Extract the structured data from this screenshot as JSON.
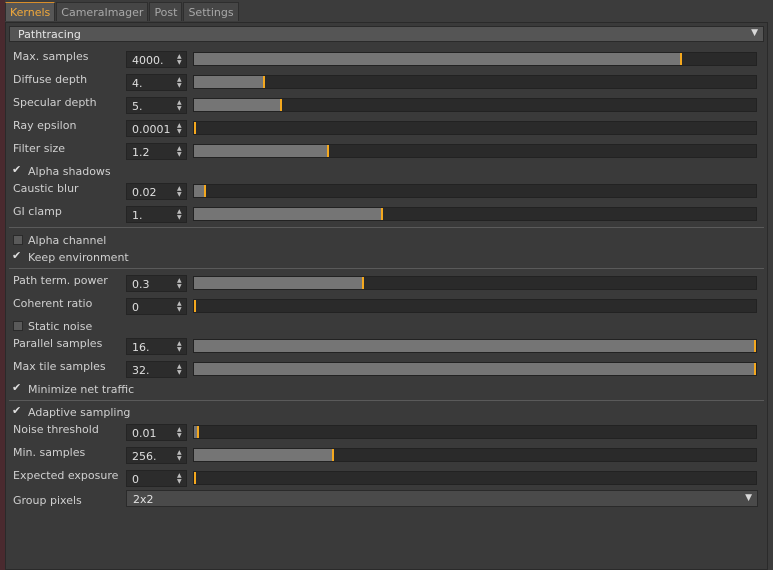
{
  "tabs": [
    "Kernels",
    "CameraImager",
    "Post",
    "Settings"
  ],
  "section": {
    "title": "Pathtracing"
  },
  "params": {
    "max_samples": {
      "label": "Max. samples",
      "value": "4000.",
      "level": 0.867
    },
    "diffuse_depth": {
      "label": "Diffuse depth",
      "value": "4.",
      "level": 0.125
    },
    "specular_depth": {
      "label": "Specular depth",
      "value": "5.",
      "level": 0.155
    },
    "ray_epsilon": {
      "label": "Ray epsilon",
      "value": "0.0001",
      "level": 0.0
    },
    "filter_size": {
      "label": "Filter size",
      "value": "1.2",
      "level": 0.238
    },
    "caustic_blur": {
      "label": "Caustic blur",
      "value": "0.02",
      "level": 0.02
    },
    "gi_clamp": {
      "label": "GI clamp",
      "value": "1.",
      "level": 0.335
    },
    "path_term_power": {
      "label": "Path term. power",
      "value": "0.3",
      "level": 0.3
    },
    "coherent_ratio": {
      "label": "Coherent ratio",
      "value": "0",
      "level": 0.0
    },
    "parallel_samples": {
      "label": "Parallel samples",
      "value": "16.",
      "level": 1.0
    },
    "max_tile_samples": {
      "label": "Max tile samples",
      "value": "32.",
      "level": 1.0
    },
    "noise_threshold": {
      "label": "Noise threshold",
      "value": "0.01",
      "level": 0.008
    },
    "min_samples": {
      "label": "Min. samples",
      "value": "256.",
      "level": 0.247
    },
    "expected_exposure": {
      "label": "Expected exposure",
      "value": "0",
      "level": 0.0
    }
  },
  "checks": {
    "alpha_shadows": {
      "label": "Alpha shadows",
      "checked": true
    },
    "alpha_channel": {
      "label": "Alpha channel",
      "checked": false
    },
    "keep_environment": {
      "label": "Keep environment",
      "checked": true
    },
    "static_noise": {
      "label": "Static noise",
      "checked": false
    },
    "minimize_net_traffic": {
      "label": "Minimize net traffic",
      "checked": true
    },
    "adaptive_sampling": {
      "label": "Adaptive sampling",
      "checked": true
    }
  },
  "group_pixels": {
    "label": "Group pixels",
    "value": "2x2"
  },
  "colors": {
    "accent": "#f4a81e",
    "fill": "#757575",
    "track": "#2a2a2a",
    "panel": "#3a3a3a"
  }
}
